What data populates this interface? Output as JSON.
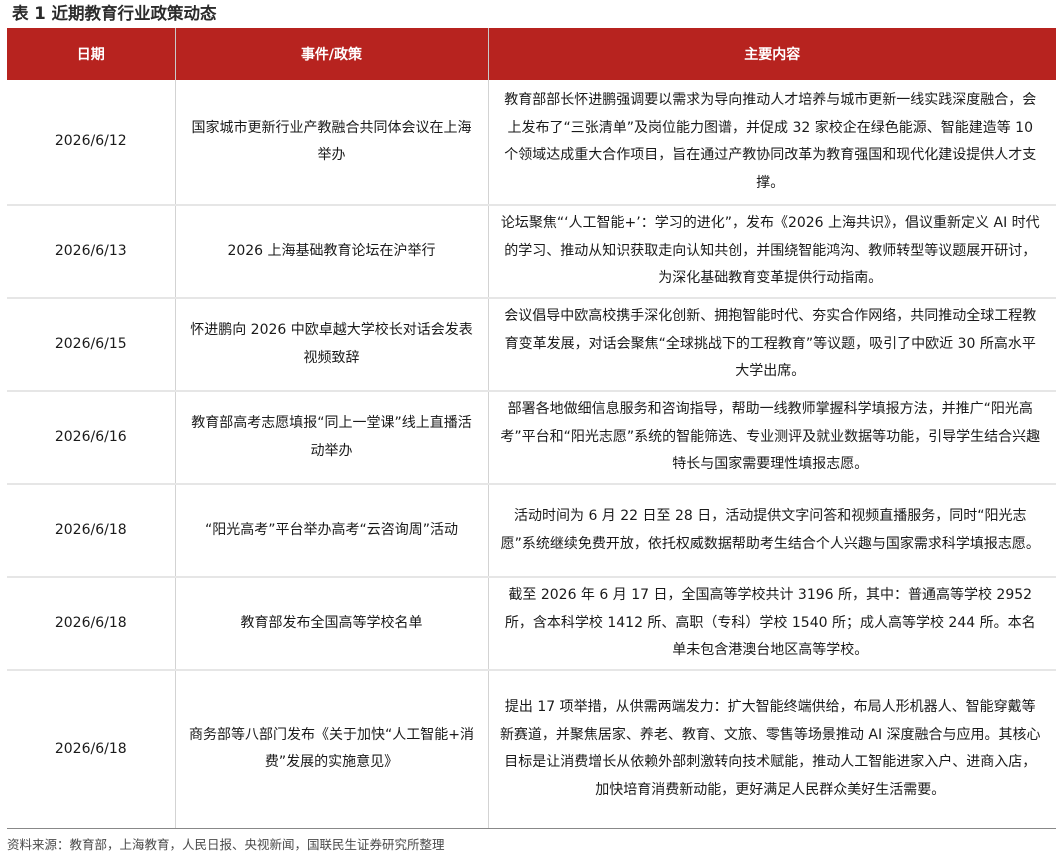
{
  "table": {
    "title": "表 1 近期教育行业政策动态",
    "headers": [
      "日期",
      "事件/政策",
      "主要内容"
    ],
    "rows": [
      {
        "date": "2026/6/12",
        "event": "国家城市更新行业产教融合共同体会议在上海举办",
        "content": "教育部部长怀进鹏强调要以需求为导向推动人才培养与城市更新一线实践深度融合，会上发布了“三张清单”及岗位能力图谱，并促成 32 家校企在绿色能源、智能建造等 10 个领域达成重大合作项目，旨在通过产教协同改革为教育强国和现代化建设提供人才支撑。"
      },
      {
        "date": "2026/6/13",
        "event": "2026 上海基础教育论坛在沪举行",
        "content": "论坛聚焦“‘人工智能+’：学习的进化”，发布《2026 上海共识》，倡议重新定义 AI 时代的学习、推动从知识获取走向认知共创，并围绕智能鸿沟、教师转型等议题展开研讨，为深化基础教育变革提供行动指南。"
      },
      {
        "date": "2026/6/15",
        "event": "怀进鹏向 2026 中欧卓越大学校长对话会发表视频致辞",
        "content": "会议倡导中欧高校携手深化创新、拥抱智能时代、夯实合作网络，共同推动全球工程教育变革发展，对话会聚焦“全球挑战下的工程教育”等议题，吸引了中欧近 30 所高水平大学出席。"
      },
      {
        "date": "2026/6/16",
        "event": "教育部高考志愿填报“同上一堂课”线上直播活动举办",
        "content": "部署各地做细信息服务和咨询指导，帮助一线教师掌握科学填报方法，并推广“阳光高考”平台和“阳光志愿”系统的智能筛选、专业测评及就业数据等功能，引导学生结合兴趣特长与国家需要理性填报志愿。"
      },
      {
        "date": "2026/6/18",
        "event": "“阳光高考”平台举办高考“云咨询周”活动",
        "content": "活动时间为 6 月 22 日至 28 日，活动提供文字问答和视频直播服务，同时“阳光志愿”系统继续免费开放，依托权威数据帮助考生结合个人兴趣与国家需求科学填报志愿。"
      },
      {
        "date": "2026/6/18",
        "event": "教育部发布全国高等学校名单",
        "content": "截至 2026 年 6 月 17 日，全国高等学校共计 3196 所，其中：普通高等学校 2952 所，含本科学校 1412 所、高职（专科）学校 1540 所；成人高等学校 244 所。本名单未包含港澳台地区高等学校。"
      },
      {
        "date": "2026/6/18",
        "event": "商务部等八部门发布《关于加快“人工智能+消费”发展的实施意见》",
        "content": "提出 17 项举措，从供需两端发力：扩大智能终端供给，布局人形机器人、智能穿戴等新赛道，并聚焦居家、养老、教育、文旅、零售等场景推动 AI 深度融合与应用。其核心目标是让消费增长从依赖外部刺激转向技术赋能，推动人工智能进家入户、进商入店，加快培育消费新动能，更好满足人民群众美好生活需要。"
      }
    ],
    "source": "资料来源：教育部，上海教育，人民日报、央视新闻，国联民生证券研究所整理"
  }
}
